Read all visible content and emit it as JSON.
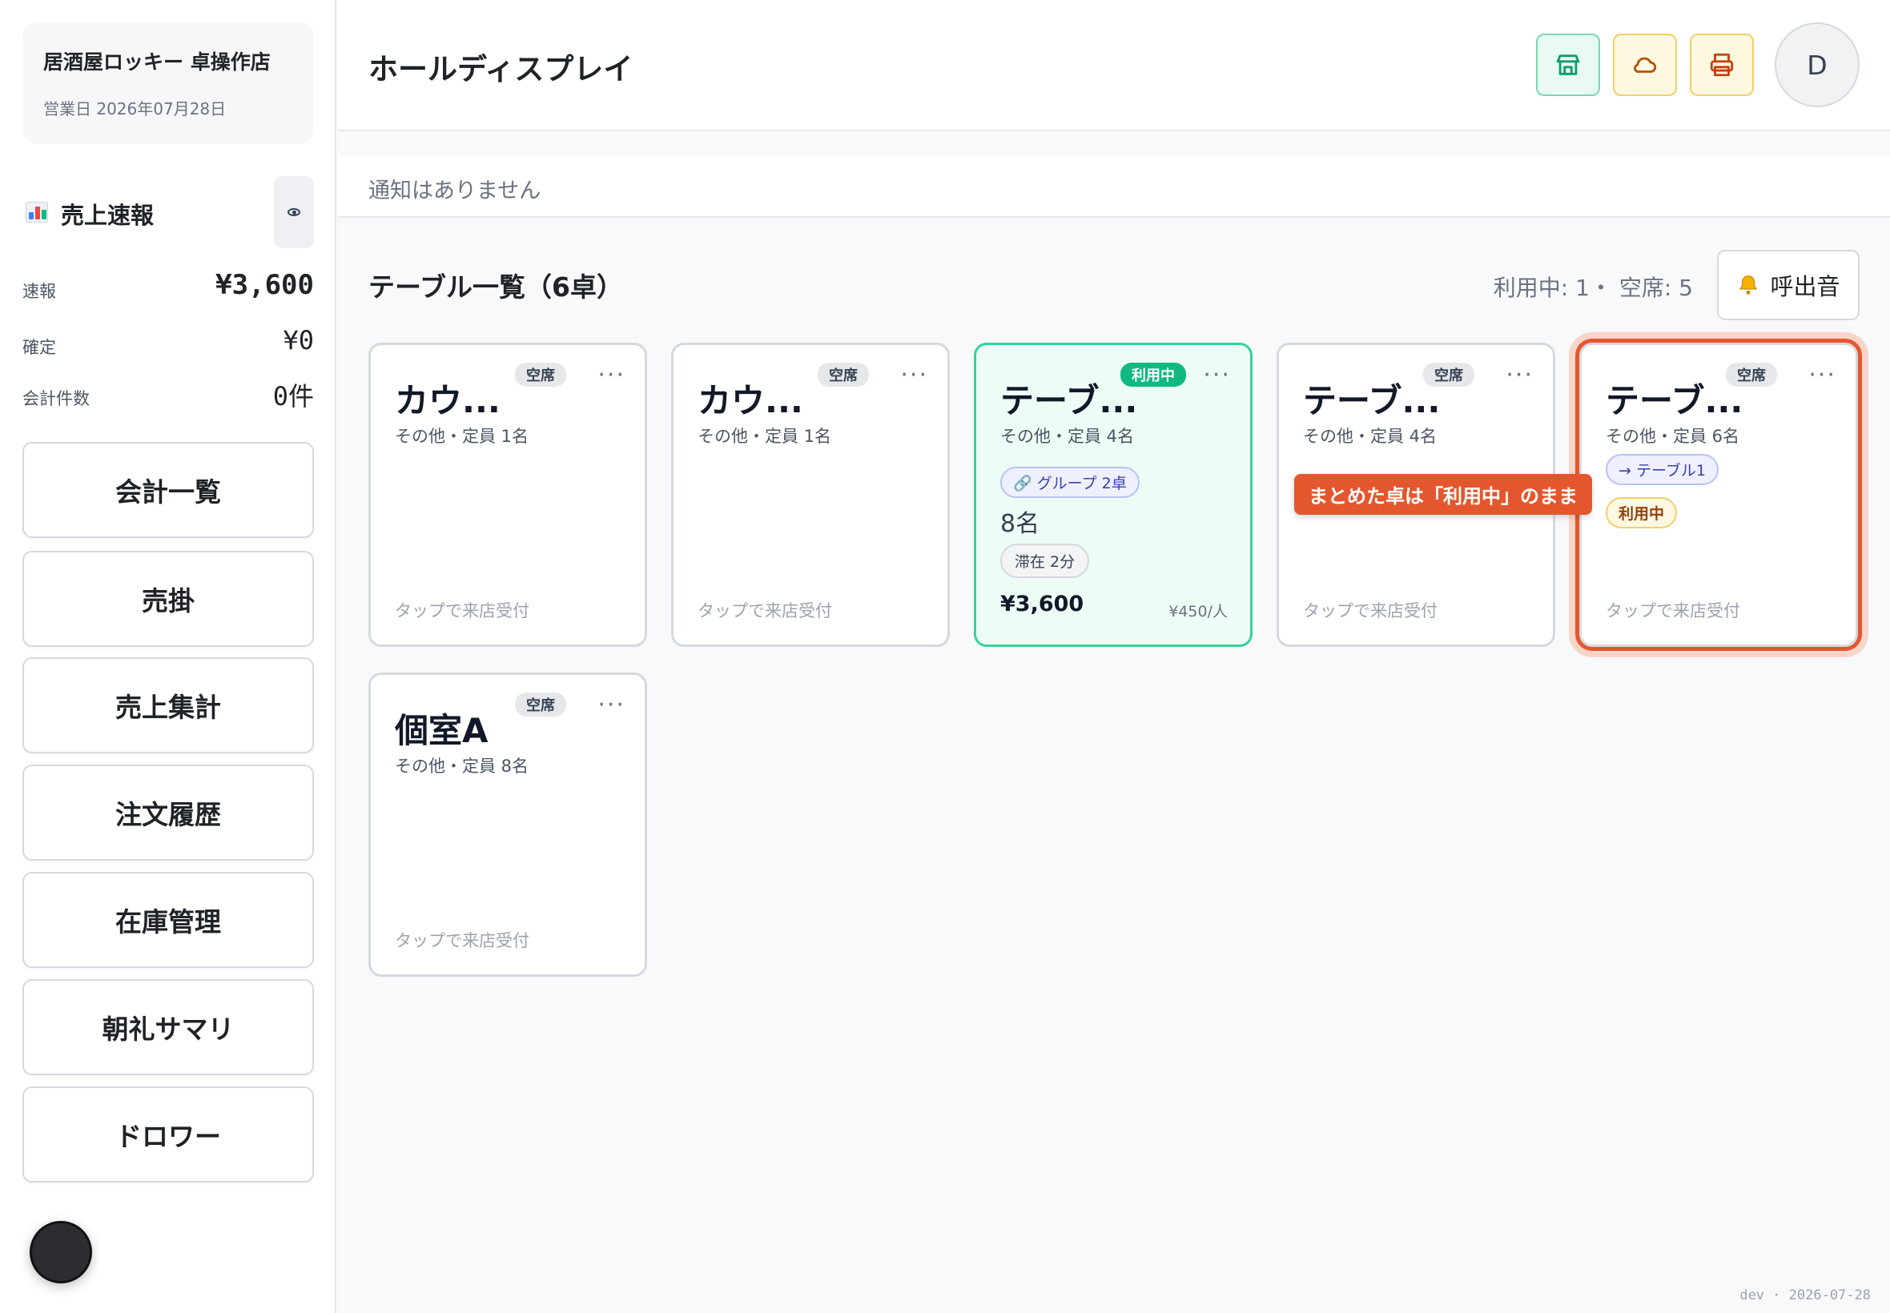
{
  "sidebar": {
    "store_name": "居酒屋ロッキー 卓操作店",
    "business_day": "営業日 2026年07月28日",
    "sales_title": "売上速報",
    "sales_icon": "bar-chart-icon",
    "eye_icon": "eye-icon",
    "stats": [
      {
        "label": "速報",
        "value": "¥3,600"
      },
      {
        "label": "確定",
        "value": "¥0"
      },
      {
        "label": "会計件数",
        "value": "0件"
      }
    ],
    "nav": [
      {
        "label": "会計一覧"
      },
      {
        "label": "売掛"
      },
      {
        "label": "売上集計"
      },
      {
        "label": "注文履歴"
      },
      {
        "label": "在庫管理"
      },
      {
        "label": "朝礼サマリ"
      },
      {
        "label": "ドロワー"
      }
    ]
  },
  "header": {
    "title": "ホールディスプレイ",
    "icons": [
      "store-icon",
      "cloud-icon",
      "printer-icon"
    ],
    "avatar": "D"
  },
  "notice": {
    "text": "通知はありません"
  },
  "tables": {
    "title": "テーブル一覧（6卓）",
    "occupancy": "利用中: 1・ 空席: 5",
    "bell_label": "呼出音",
    "bell_icon": "bell-icon",
    "items": [
      {
        "name": "カウ...",
        "status": "空席",
        "sub": "その他・定員 1名",
        "foot": "タップで来店受付"
      },
      {
        "name": "カウ...",
        "status": "空席",
        "sub": "その他・定員 1名",
        "foot": "タップで来店受付"
      },
      {
        "name": "テーブ...",
        "status": "利用中",
        "sub": "その他・定員 4名",
        "group": "グループ 2卓",
        "guests": "8名",
        "stay": "滞在 2分",
        "amount": "¥3,600",
        "per_person": "¥450/人"
      },
      {
        "name": "テーブ...",
        "status": "空席",
        "sub": "その他・定員 4名",
        "foot": "タップで来店受付"
      },
      {
        "name": "テーブ...",
        "status": "空席",
        "sub": "その他・定員 6名",
        "link": "→ テーブル1",
        "inuse": "利用中",
        "foot": "タップで来店受付"
      },
      {
        "name": "個室A",
        "status": "空席",
        "sub": "その他・定員 8名",
        "foot": "タップで来店受付"
      }
    ],
    "more": "···"
  },
  "callout": "まとめた卓は「利用中」のまま",
  "version": "dev · 2026-07-28",
  "colors": {
    "accent_green": "#10b981",
    "highlight_red": "#e4572e",
    "amber": "#f2cf68"
  }
}
